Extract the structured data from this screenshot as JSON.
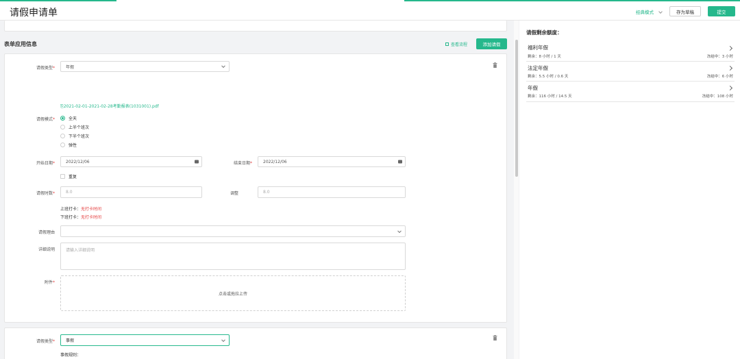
{
  "header": {
    "title": "请假申请单",
    "mode_label": "经典模式",
    "save_draft": "存为草稿",
    "submit": "提交"
  },
  "section": {
    "title": "表单应用信息",
    "view_flow": "查看流程",
    "add_leave": "添加请假"
  },
  "form1": {
    "leave_type_label": "请假类型",
    "leave_type_value": "年假",
    "attachment_link": "2021-02-01-2021-02-28考勤报表(1031001).pdf",
    "leave_mode_label": "请假模式",
    "modes": [
      "全天",
      "上半个班次",
      "下半个班次",
      "弹性"
    ],
    "start_label": "开始日期",
    "start_value": "2022/12/06",
    "end_label": "结束日期",
    "end_value": "2022/12/06",
    "repeat_label": "重复",
    "duration_label": "请假时数",
    "duration_value": "8.0",
    "adjust_label": "调整",
    "adjust_value": "8.0",
    "clock_in_label": "上班打卡：",
    "clock_in_value": "无打卡时间",
    "clock_out_label": "下班打卡：",
    "clock_out_value": "无打卡时间",
    "reason_label": "请假理由",
    "detail_label": "详细说明",
    "detail_placeholder": "请输入详细说明",
    "attach_label": "附件",
    "upload_hint": "点击或拖拉上传"
  },
  "form2": {
    "leave_type_label": "请假类型",
    "leave_type_value": "事假",
    "rule_label": "事假规则："
  },
  "balance": {
    "title": "请假剩余额度：",
    "items": [
      {
        "name": "福利年假",
        "remain": "剩余：8 小时 / 1 天",
        "frozen": "冻结中：3 小时"
      },
      {
        "name": "法定年假",
        "remain": "剩余：5.5 小时 / 0.6 天",
        "frozen": "冻结中：6 小时"
      },
      {
        "name": "年假",
        "remain": "剩余：116 小时 / 14.5 天",
        "frozen": "冻结中：108 小时"
      }
    ]
  },
  "colors": {
    "accent": "#25b88c",
    "danger": "#e43d3d"
  }
}
